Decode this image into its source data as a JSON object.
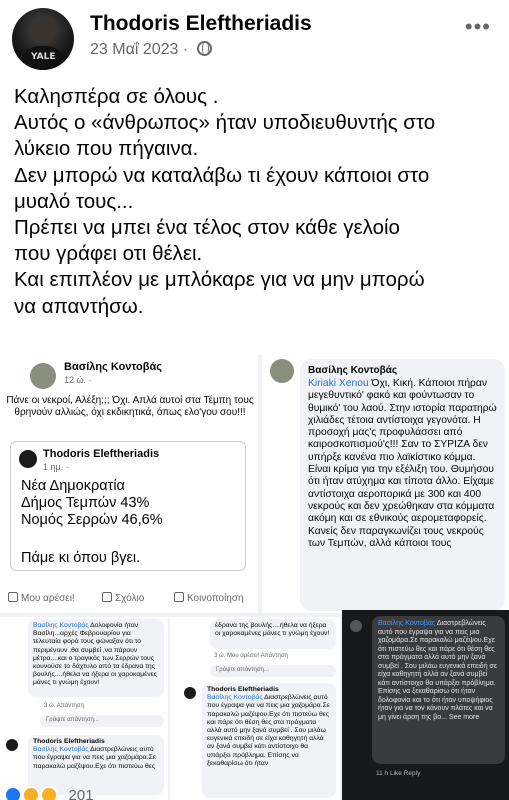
{
  "post": {
    "author": "Thodoris Eleftheriadis",
    "date": "23 Μαΐ 2023",
    "separator": "·",
    "more_icon": "more-horizontal-icon",
    "lines": [
      "Καλησπέρα σε όλους .",
      "Αυτός ο «άνθρωπος» ήταν υποδιευθυντής στο",
      "λύκειο που πήγαινα.",
      "Δεν μπορώ να καταλάβω τι έχουν κάποιοι στο",
      "μυαλό τους...",
      "Πρέπει να μπει ένα τέλος στον κάθε γελοίο",
      "που γράφει οτι θέλει.",
      "Και επιπλέον με μπλόκαρε για να μην μπορώ",
      "να απαντήσω."
    ]
  },
  "screenshot1": {
    "author": "Βασίλης Κοντοβάς",
    "time": "12 ώ. ·",
    "text": "Πάνε οι νεκροί, Αλέξη;;; Όχι. Απλά αυτοί στα Τέμπη τους θρηνούν αλλιώς, όχι εκδικητικά, όπως ελο'γου σου!!!",
    "quote_author": "Thodoris Eleftheriadis",
    "quote_time": "1 ημ. ·",
    "quote_lines": [
      "Νέα Δημοκρατία",
      "Δήμος Τεμπών 43%",
      "Νομός Σερρών 46,6%"
    ],
    "quote_footer": "Πάμε κι όπου βγει.",
    "like_label": "Μου αρέσει!",
    "comment_label": "Σχόλιο",
    "share_label": "Κοινοποίηση"
  },
  "screenshot2": {
    "author": "Βασίλης Κοντοβάς",
    "mention": "Kiriaki Xenou",
    "text": "Όχι, Κική. Κάποιοι πήραν μεγεθυντικό' φακό και φούντωσαν το θυμικό' του λαού. Στην ιστορία παρατηρώ χιλιάδες τέτοια αντίστοιχα γεγονότα. Η προσοχή μας'ς προφυλάσσει από καιροσκοπισμού'ς!!! Σαν το ΣΥΡΙΖΑ δεν υπήρξε κανένα πιο λαϊκίστικο κόμμα. Είναι κρίμα για την εξέλιξη του. Θυμήσου ότι ήταν ατύχημα και τίποτα άλλο. Είχαμε αντίστοιχα αεροπορικά με 300 και 400 νεκρούς και δεν χρεώθηκαν στα κόμματα ακόμη και σε εθνικούς αερομεταφορείς. Κανείς δεν παραγκωνίζει τους νεκρούς των Τεμπών, αλλά κάποιοι τους"
  },
  "screenshot3": {
    "mention": "Βασίλης Κοντοβάς",
    "text1": "Δολοφονία ήταν Βασίλη...αρχές Φεβρουαρίου για τελευταία φορά τους φώναξαν ότι το περιμένουν ,θα συμβεί ,να πάρουν μέτρα....και ο τραγικός των Σερρών τους κουνούσε το δάχτυλο από τα έδρανα της βουλής....ήθελα να ήξερα οι χαροκαμένες μάνες τι γνώμη έχουν!",
    "meta1": "3 ώ.   Απάντηση",
    "input_placeholder": "Γράψτε απάντηση...",
    "name2": "Thodoris Eleftheriadis",
    "mention2": "Βασίλης Κοντοβάς",
    "text2": "Διαστρεβλώνεις αυτό που έγραψα για να πεις μια χαζομάρα.Σε παρακαλώ μαζέψου.Εχε ότι πιστεύω θες"
  },
  "screenshot4": {
    "text1": "έδρανα της βουλής....ήθελα να ήξερα οι χαροκαμένες μάνες τι γνώμη έχουν!",
    "meta1": "3 ώ.   Μου αρέσει!   Απάντηση",
    "input_placeholder": "Γράψτε απάντηση...",
    "name2": "Thodoris Eleftheriadis",
    "mention2": "Βασίλης Κοντοβάς",
    "text2": "Διαστρεβλώνεις αυτό που έγραψα για να πεις μια χαζομάρα.Σε παρακαλώ μαζέψου.Εχε ότι πιστεύω θες και πάρε ότι θέση θες στα πράγματα αλλά αυτό μην ξανά συμβεί . Σου μιλάω ευγενικά επειδή σε είχα καθηγητή αλλά αν ξανά συμβεί κάτι αντίστοιχο θα υπάρξει πρόβλημα. Επίσης να ξεκαθαρίσω ότι ήταν"
  },
  "screenshot5": {
    "mention": "Βασίλης Κοντοβάς",
    "text": "Διαστρεβλώνεις αυτό που έγραψα για να πεις μια χαζομάρα.Σε παρακαλώ μαζέψου.Εχε ότι πιστεύω θες και πάρε ότι θέση θες στα πράγματα αλλά αυτό μην ξανά συμβεί . Σου μιλάω ευγενικά επειδή σε είχα καθηγητή αλλά αν ξανά συμβεί κάτι αντίστοιχο θα υπάρξει πρόβλημα. Επίσης να ξεκαθαρίσω ότι ήταν δολοφονία και το ότι ήταν υποψήφιος ήταν για να τον κάνουν πλάτες και να μη γίνει άρση της βο... See more",
    "meta": "11 h   Like   Reply"
  },
  "reactions": {
    "count": "201"
  }
}
